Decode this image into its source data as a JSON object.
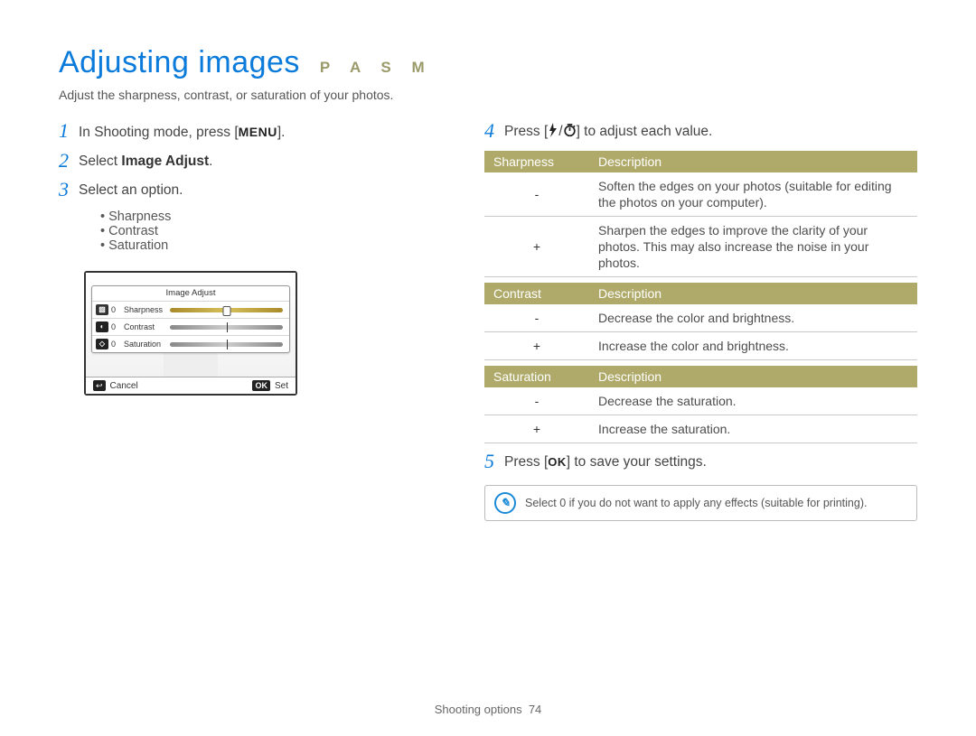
{
  "title": "Adjusting images",
  "modes": "P A S M",
  "subtitle": "Adjust the sharpness, contrast, or saturation of your photos.",
  "steps_left": {
    "s1_num": "1",
    "s1_pre": "In Shooting mode, press [",
    "s1_key": "MENU",
    "s1_post": "].",
    "s2_num": "2",
    "s2_pre": "Select ",
    "s2_bold": "Image Adjust",
    "s2_post": ".",
    "s3_num": "3",
    "s3_text": "Select an option.",
    "bullets": [
      "Sharpness",
      "Contrast",
      "Saturation"
    ]
  },
  "screen": {
    "panel_title": "Image Adjust",
    "rows": [
      {
        "icon": "▧",
        "zero": "0",
        "label": "Sharpness"
      },
      {
        "icon": "◐",
        "zero": "0",
        "label": "Contrast"
      },
      {
        "icon": "◇",
        "zero": "0",
        "label": "Saturation"
      }
    ],
    "footer_back_icon": "↩",
    "footer_cancel": "Cancel",
    "footer_ok": "OK",
    "footer_set": "Set"
  },
  "steps_right": {
    "s4_num": "4",
    "s4_pre": "Press [",
    "s4_sep": "/",
    "s4_post": "] to adjust each value.",
    "s5_num": "5",
    "s5_pre": "Press [",
    "s5_key": "OK",
    "s5_post": "] to save your settings."
  },
  "tables": {
    "sharpness": {
      "h1": "Sharpness",
      "h2": "Description",
      "rows": [
        {
          "sym": "-",
          "desc": "Soften the edges on your photos (suitable for editing the photos on your computer)."
        },
        {
          "sym": "+",
          "desc": "Sharpen the edges to improve the clarity of your photos. This may also increase the noise in your photos."
        }
      ]
    },
    "contrast": {
      "h1": "Contrast",
      "h2": "Description",
      "rows": [
        {
          "sym": "-",
          "desc": "Decrease the color and brightness."
        },
        {
          "sym": "+",
          "desc": "Increase the color and brightness."
        }
      ]
    },
    "saturation": {
      "h1": "Saturation",
      "h2": "Description",
      "rows": [
        {
          "sym": "-",
          "desc": "Decrease the saturation."
        },
        {
          "sym": "+",
          "desc": "Increase the saturation."
        }
      ]
    }
  },
  "note": "Select 0 if you do not want to apply any effects (suitable for printing).",
  "footer_section": "Shooting options",
  "footer_page": "74"
}
